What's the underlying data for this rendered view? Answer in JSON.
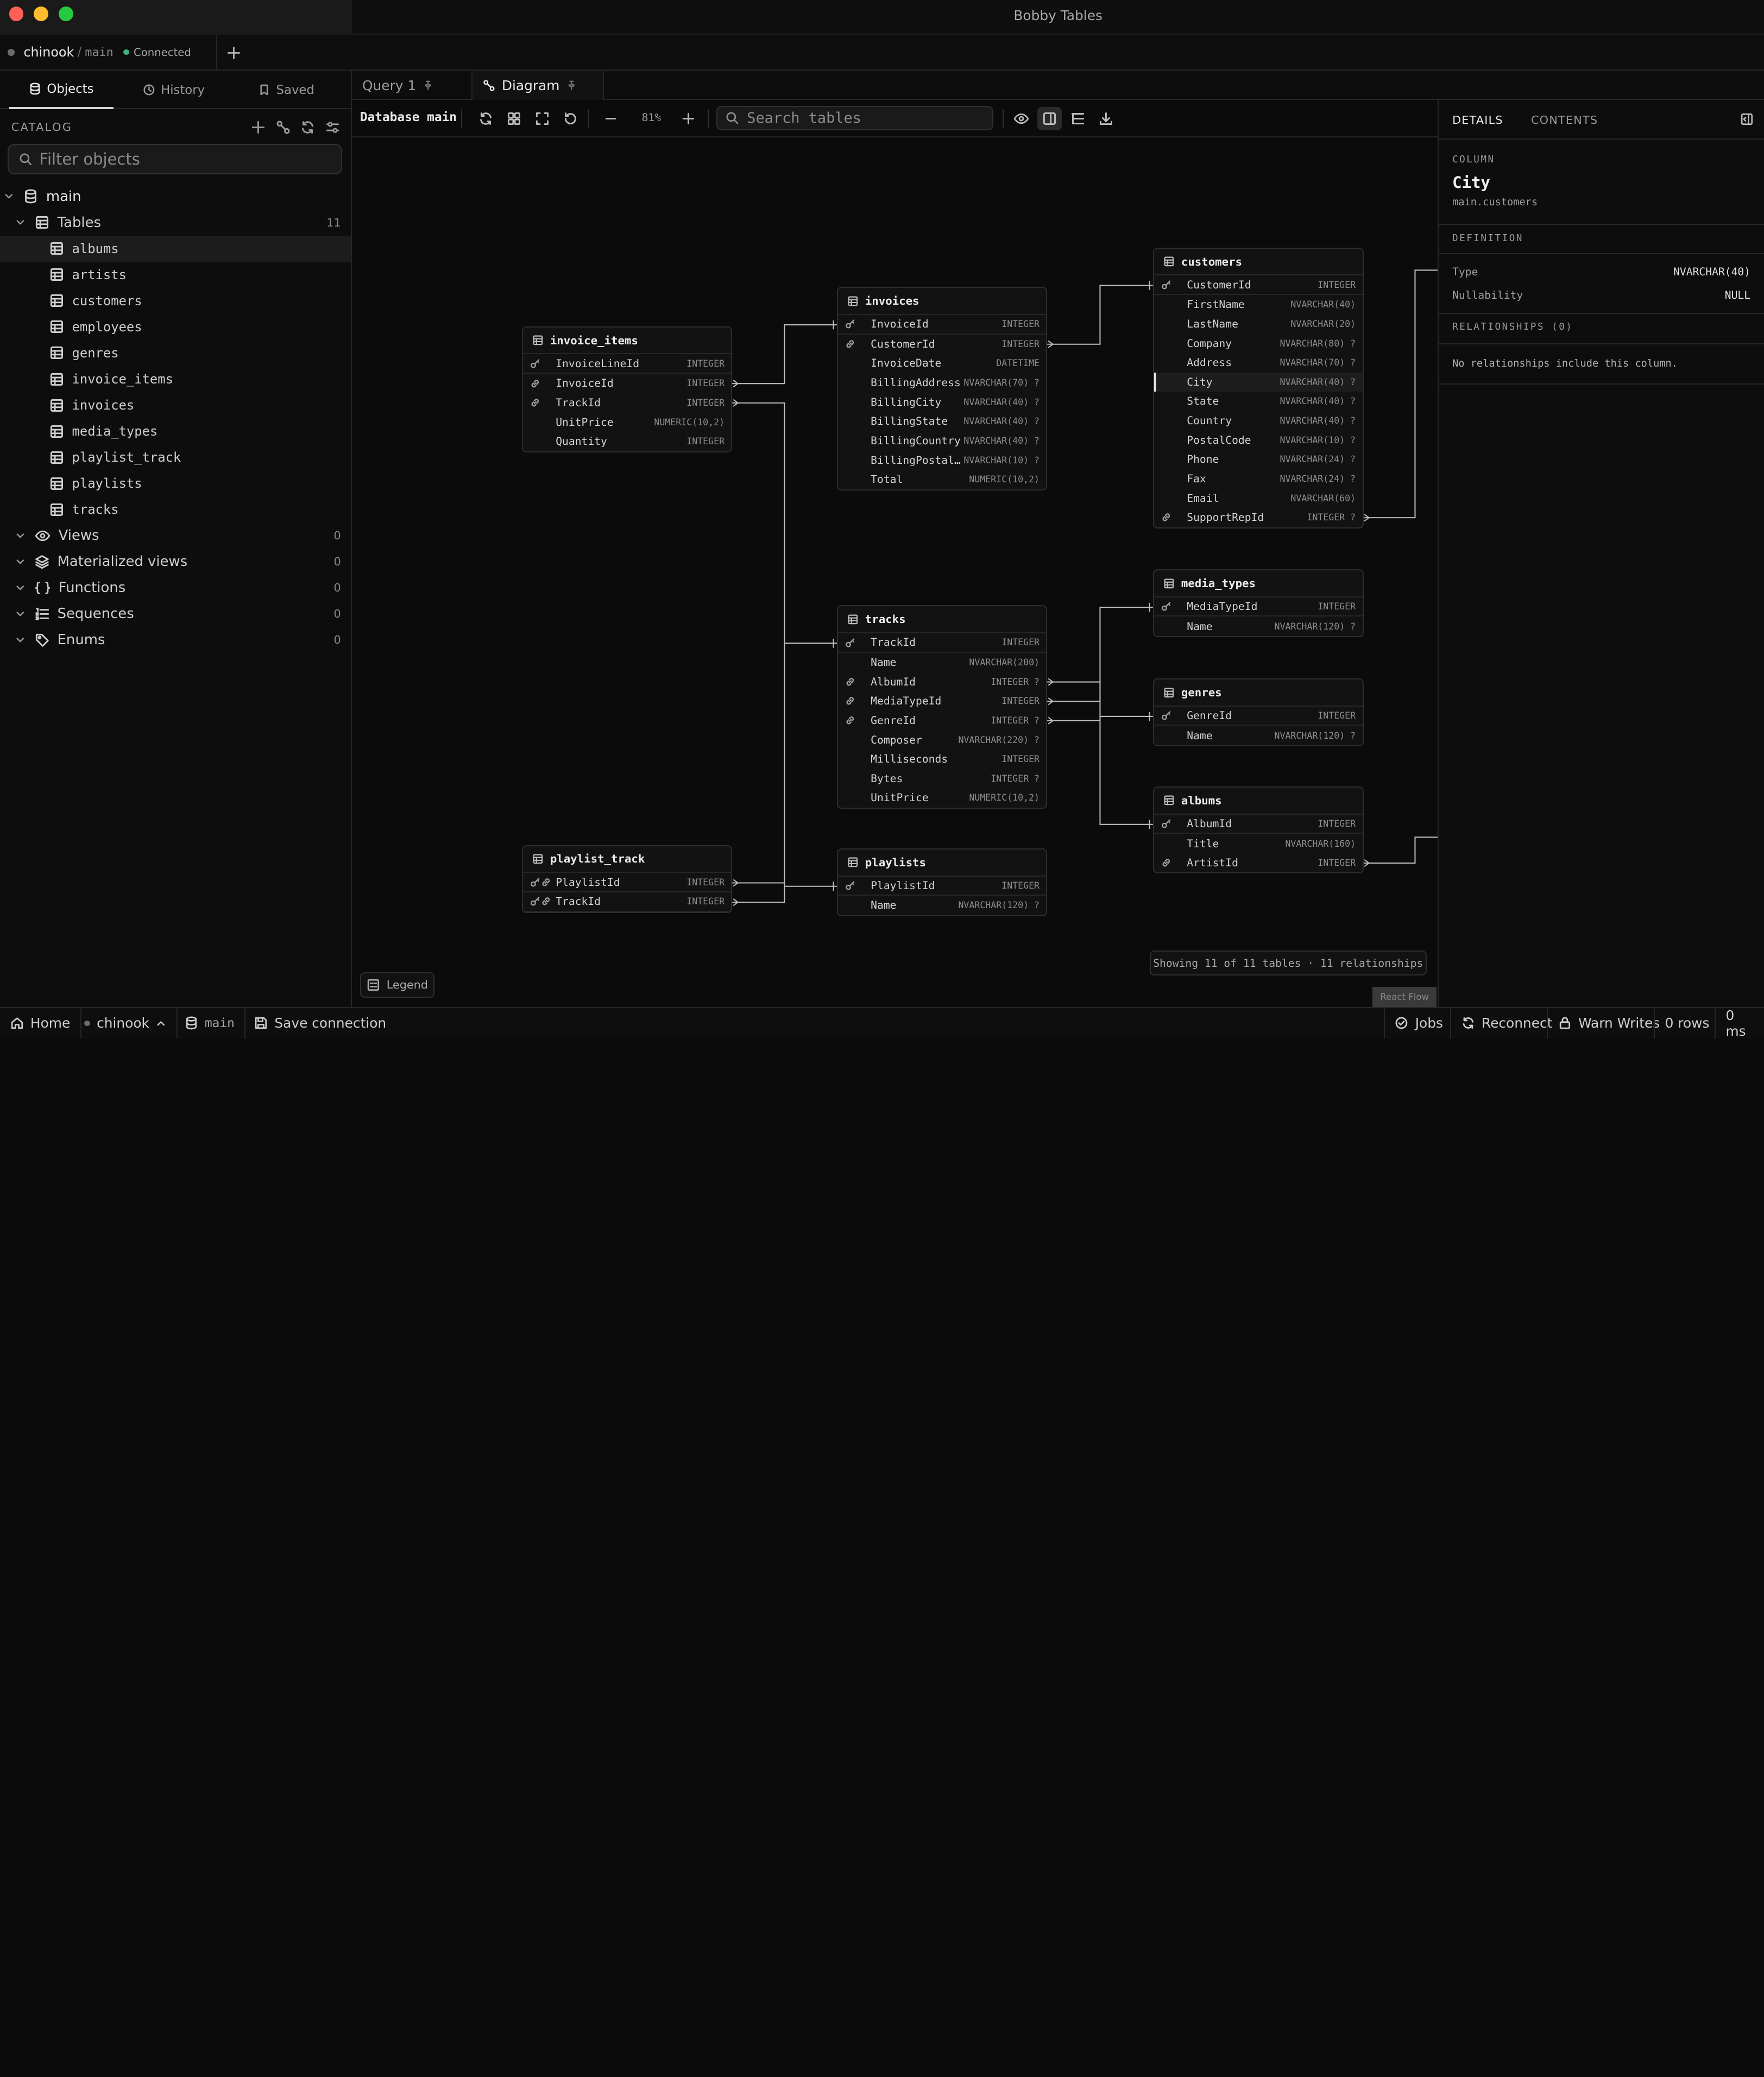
{
  "window": {
    "title": "Bobby Tables"
  },
  "connection": {
    "name": "chinook",
    "separator": "/",
    "schema": "main",
    "status": "Connected"
  },
  "sidebar": {
    "tabs": [
      {
        "label": "Objects",
        "icon": "database-icon"
      },
      {
        "label": "History",
        "icon": "clock-icon"
      },
      {
        "label": "Saved",
        "icon": "bookmark-icon"
      }
    ],
    "catalog_label": "CATALOG",
    "filter_placeholder": "Filter objects",
    "tree": {
      "root": "main",
      "groups": [
        {
          "label": "Tables",
          "count": "11"
        },
        {
          "label": "Views",
          "count": "0"
        },
        {
          "label": "Materialized views",
          "count": "0"
        },
        {
          "label": "Functions",
          "count": "0"
        },
        {
          "label": "Sequences",
          "count": "0"
        },
        {
          "label": "Enums",
          "count": "0"
        }
      ],
      "tables": [
        "albums",
        "artists",
        "customers",
        "employees",
        "genres",
        "invoice_items",
        "invoices",
        "media_types",
        "playlist_track",
        "playlists",
        "tracks"
      ]
    }
  },
  "tabs": [
    {
      "label": "Query 1"
    },
    {
      "label": "Diagram"
    }
  ],
  "toolbar": {
    "database_label": "Database main",
    "zoom": "81%",
    "search_placeholder": "Search tables"
  },
  "diagram": {
    "tables": {
      "invoice_items": {
        "name": "invoice_items",
        "columns": [
          {
            "name": "InvoiceLineId",
            "type": "INTEGER"
          },
          {
            "name": "InvoiceId",
            "type": "INTEGER"
          },
          {
            "name": "TrackId",
            "type": "INTEGER"
          },
          {
            "name": "UnitPrice",
            "type": "NUMERIC(10,2)"
          },
          {
            "name": "Quantity",
            "type": "INTEGER"
          }
        ]
      },
      "invoices": {
        "name": "invoices",
        "columns": [
          {
            "name": "InvoiceId",
            "type": "INTEGER"
          },
          {
            "name": "CustomerId",
            "type": "INTEGER"
          },
          {
            "name": "InvoiceDate",
            "type": "DATETIME"
          },
          {
            "name": "BillingAddress",
            "type": "NVARCHAR(70) ?"
          },
          {
            "name": "BillingCity",
            "type": "NVARCHAR(40) ?"
          },
          {
            "name": "BillingState",
            "type": "NVARCHAR(40) ?"
          },
          {
            "name": "BillingCountry",
            "type": "NVARCHAR(40) ?"
          },
          {
            "name": "BillingPostalCode",
            "type": "NVARCHAR(10) ?"
          },
          {
            "name": "Total",
            "type": "NUMERIC(10,2)"
          }
        ]
      },
      "customers": {
        "name": "customers",
        "columns": [
          {
            "name": "CustomerId",
            "type": "INTEGER"
          },
          {
            "name": "FirstName",
            "type": "NVARCHAR(40)"
          },
          {
            "name": "LastName",
            "type": "NVARCHAR(20)"
          },
          {
            "name": "Company",
            "type": "NVARCHAR(80) ?"
          },
          {
            "name": "Address",
            "type": "NVARCHAR(70) ?"
          },
          {
            "name": "City",
            "type": "NVARCHAR(40) ?"
          },
          {
            "name": "State",
            "type": "NVARCHAR(40) ?"
          },
          {
            "name": "Country",
            "type": "NVARCHAR(40) ?"
          },
          {
            "name": "PostalCode",
            "type": "NVARCHAR(10) ?"
          },
          {
            "name": "Phone",
            "type": "NVARCHAR(24) ?"
          },
          {
            "name": "Fax",
            "type": "NVARCHAR(24) ?"
          },
          {
            "name": "Email",
            "type": "NVARCHAR(60)"
          },
          {
            "name": "SupportRepId",
            "type": "INTEGER ?"
          }
        ]
      },
      "media_types": {
        "name": "media_types",
        "columns": [
          {
            "name": "MediaTypeId",
            "type": "INTEGER"
          },
          {
            "name": "Name",
            "type": "NVARCHAR(120) ?"
          }
        ]
      },
      "tracks": {
        "name": "tracks",
        "columns": [
          {
            "name": "TrackId",
            "type": "INTEGER"
          },
          {
            "name": "Name",
            "type": "NVARCHAR(200)"
          },
          {
            "name": "AlbumId",
            "type": "INTEGER ?"
          },
          {
            "name": "MediaTypeId",
            "type": "INTEGER"
          },
          {
            "name": "GenreId",
            "type": "INTEGER ?"
          },
          {
            "name": "Composer",
            "type": "NVARCHAR(220) ?"
          },
          {
            "name": "Milliseconds",
            "type": "INTEGER"
          },
          {
            "name": "Bytes",
            "type": "INTEGER ?"
          },
          {
            "name": "UnitPrice",
            "type": "NUMERIC(10,2)"
          }
        ]
      },
      "genres": {
        "name": "genres",
        "columns": [
          {
            "name": "GenreId",
            "type": "INTEGER"
          },
          {
            "name": "Name",
            "type": "NVARCHAR(120) ?"
          }
        ]
      },
      "albums": {
        "name": "albums",
        "columns": [
          {
            "name": "AlbumId",
            "type": "INTEGER"
          },
          {
            "name": "Title",
            "type": "NVARCHAR(160)"
          },
          {
            "name": "ArtistId",
            "type": "INTEGER"
          }
        ]
      },
      "playlist_track": {
        "name": "playlist_track",
        "columns": [
          {
            "name": "PlaylistId",
            "type": "INTEGER"
          },
          {
            "name": "TrackId",
            "type": "INTEGER"
          }
        ]
      },
      "playlists": {
        "name": "playlists",
        "columns": [
          {
            "name": "PlaylistId",
            "type": "INTEGER"
          },
          {
            "name": "Name",
            "type": "NVARCHAR(120) ?"
          }
        ]
      }
    },
    "showing": "Showing 11 of 11 tables · 11 relationships",
    "legend_label": "Legend",
    "attribution": "React Flow"
  },
  "details": {
    "tabs": [
      "DETAILS",
      "CONTENTS"
    ],
    "column_label": "COLUMN",
    "column_name": "City",
    "column_path": "main.customers",
    "definition_label": "DEFINITION",
    "type_key": "Type",
    "type_value": "NVARCHAR(40)",
    "nullability_key": "Nullability",
    "nullability_value": "NULL",
    "relationships_label": "RELATIONSHIPS (0)",
    "relationships_empty": "No relationships include this column."
  },
  "statusbar": {
    "home": "Home",
    "connection": "chinook",
    "schema": "main",
    "save": "Save connection",
    "jobs": "Jobs",
    "reconnect": "Reconnect",
    "warn": "Warn Writes",
    "rows": "0 rows",
    "time": "0 ms"
  },
  "colors": {
    "background": "#0b0b0b",
    "panel": "#0d0d0d",
    "border": "#262626",
    "connected": "#3fb37f",
    "close": "#ff5f57",
    "minimize": "#febc2e",
    "maximize": "#28c840"
  }
}
